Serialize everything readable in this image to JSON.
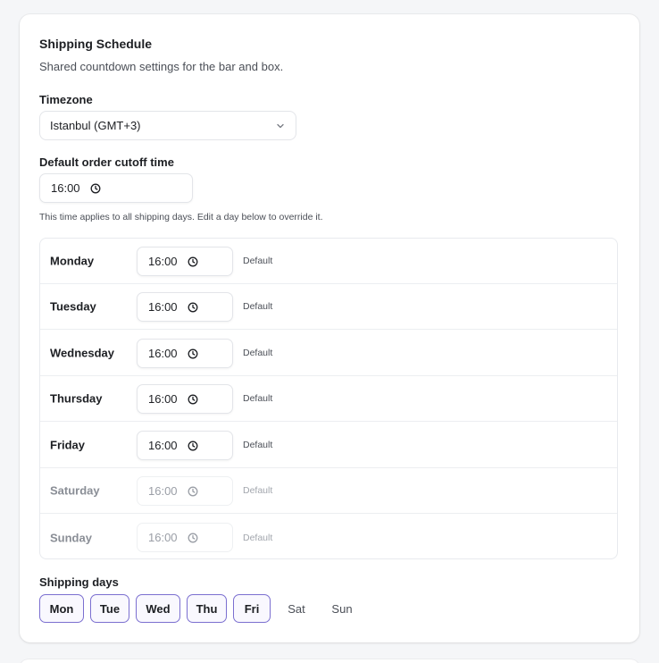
{
  "section": {
    "title": "Shipping Schedule",
    "subtitle": "Shared countdown settings for the bar and box."
  },
  "timezone": {
    "label": "Timezone",
    "value": "Istanbul (GMT+3)"
  },
  "cutoff": {
    "label": "Default order cutoff time",
    "value": "16:00",
    "hint": "This time applies to all shipping days. Edit a day below to override it."
  },
  "days": [
    {
      "name": "Monday",
      "time": "16:00",
      "status": "Default",
      "enabled": true
    },
    {
      "name": "Tuesday",
      "time": "16:00",
      "status": "Default",
      "enabled": true
    },
    {
      "name": "Wednesday",
      "time": "16:00",
      "status": "Default",
      "enabled": true
    },
    {
      "name": "Thursday",
      "time": "16:00",
      "status": "Default",
      "enabled": true
    },
    {
      "name": "Friday",
      "time": "16:00",
      "status": "Default",
      "enabled": true
    },
    {
      "name": "Saturday",
      "time": "16:00",
      "status": "Default",
      "enabled": false
    },
    {
      "name": "Sunday",
      "time": "16:00",
      "status": "Default",
      "enabled": false
    }
  ],
  "shipping_days": {
    "label": "Shipping days",
    "options": [
      {
        "label": "Mon",
        "selected": true
      },
      {
        "label": "Tue",
        "selected": true
      },
      {
        "label": "Wed",
        "selected": true
      },
      {
        "label": "Thu",
        "selected": true
      },
      {
        "label": "Fri",
        "selected": true
      },
      {
        "label": "Sat",
        "selected": false
      },
      {
        "label": "Sun",
        "selected": false
      }
    ]
  },
  "colors": {
    "accent": "#7b6fd0",
    "text": "#1d1f23",
    "muted": "#4b4f57"
  },
  "icons": {
    "select": "chevron-down-icon",
    "time": "clock-icon"
  }
}
